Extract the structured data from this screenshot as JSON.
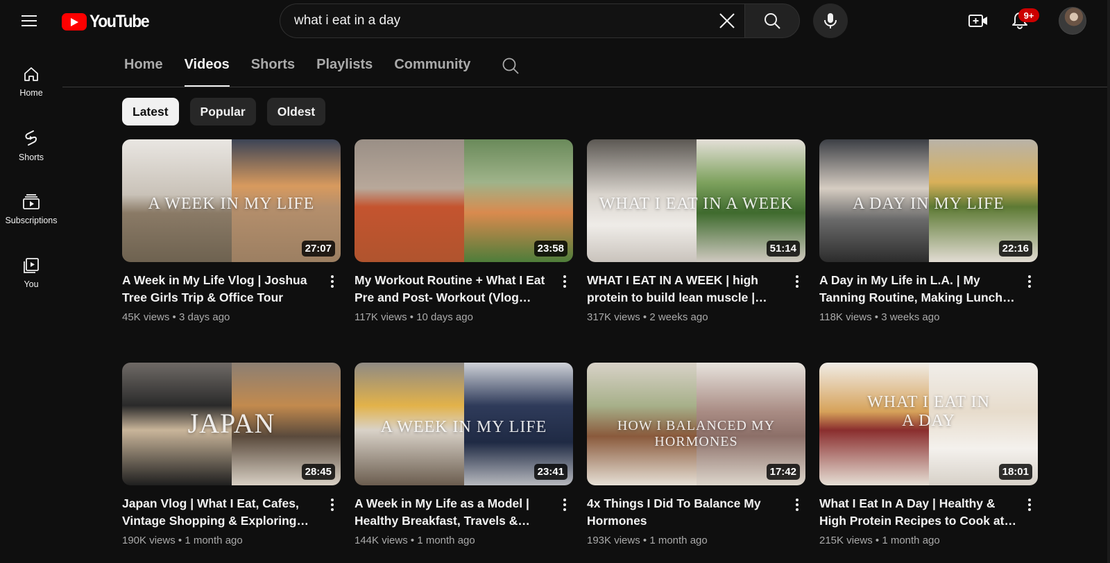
{
  "header": {
    "logo_text": "YouTube",
    "search": {
      "value": "what i eat in a day"
    },
    "notification_count": "9+"
  },
  "sidebar": {
    "items": [
      {
        "label": "Home",
        "icon": "home-icon"
      },
      {
        "label": "Shorts",
        "icon": "shorts-icon"
      },
      {
        "label": "Subscriptions",
        "icon": "subscriptions-icon"
      },
      {
        "label": "You",
        "icon": "you-icon"
      }
    ]
  },
  "tabs": [
    {
      "label": "Home",
      "active": false
    },
    {
      "label": "Videos",
      "active": true
    },
    {
      "label": "Shorts",
      "active": false
    },
    {
      "label": "Playlists",
      "active": false
    },
    {
      "label": "Community",
      "active": false
    }
  ],
  "chips": [
    {
      "label": "Latest",
      "selected": true
    },
    {
      "label": "Popular",
      "selected": false
    },
    {
      "label": "Oldest",
      "selected": false
    }
  ],
  "videos": [
    {
      "title": "A Week in My Life Vlog | Joshua Tree Girls Trip & Office Tour",
      "views": "45K views",
      "age": "3 days ago",
      "duration": "27:07",
      "overlay": "A Week in My Life"
    },
    {
      "title": "My Workout Routine + What I Eat Pre and Post- Workout (Vlog Style!)",
      "views": "117K views",
      "age": "10 days ago",
      "duration": "23:58",
      "overlay": ""
    },
    {
      "title": "WHAT I EAT IN A WEEK | high protein to build lean muscle | easy meals",
      "views": "317K views",
      "age": "2 weeks ago",
      "duration": "51:14",
      "overlay": "What I Eat In A Week"
    },
    {
      "title": "A Day in My Life in L.A. | My Tanning Routine, Making Lunch & Motivation",
      "views": "118K views",
      "age": "3 weeks ago",
      "duration": "22:16",
      "overlay": "A Day In My Life"
    },
    {
      "title": "Japan Vlog | What I Eat, Cafes, Vintage Shopping & Exploring Tokyo",
      "views": "190K views",
      "age": "1 month ago",
      "duration": "28:45",
      "overlay": "Japan"
    },
    {
      "title": "A Week in My Life as a Model | Healthy Breakfast, Travels & Workouts",
      "views": "144K views",
      "age": "1 month ago",
      "duration": "23:41",
      "overlay": "A Week In My Life"
    },
    {
      "title": "4x Things I Did To Balance My Hormones",
      "views": "193K views",
      "age": "1 month ago",
      "duration": "17:42",
      "overlay": "How I Balanced My Hormones"
    },
    {
      "title": "What I Eat In A Day | Healthy & High Protein Recipes to Cook at Home",
      "views": "215K views",
      "age": "1 month ago",
      "duration": "18:01",
      "overlay": "What I Eat In A Day"
    }
  ],
  "stats_separator": "•"
}
